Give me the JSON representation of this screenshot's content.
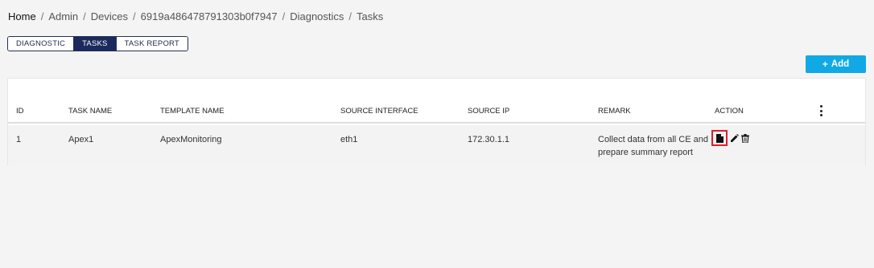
{
  "breadcrumb": {
    "home": "Home",
    "admin": "Admin",
    "devices": "Devices",
    "device_id": "6919a486478791303b0f7947",
    "diagnostics": "Diagnostics",
    "current": "Tasks",
    "separator": "/"
  },
  "tabs": [
    {
      "label": "DIAGNOSTIC",
      "active": false
    },
    {
      "label": "TASKS",
      "active": true
    },
    {
      "label": "TASK REPORT",
      "active": false
    }
  ],
  "add_button": {
    "icon": "plus-icon",
    "label": "Add",
    "glyph": "+",
    "color": "#10a9e6"
  },
  "table": {
    "columns": {
      "id": "ID",
      "task_name": "TASK NAME",
      "template_name": "TEMPLATE NAME",
      "source_interface": "SOURCE INTERFACE",
      "source_ip": "SOURCE IP",
      "remark": "REMARK",
      "action": "ACTION"
    },
    "rows": [
      {
        "id": "1",
        "task_name": "Apex1",
        "template_name": "ApexMonitoring",
        "source_interface": "eth1",
        "source_ip": "172.30.1.1",
        "remark": "Collect data from all CE and prepare summary report",
        "actions": [
          "report-icon",
          "edit-icon",
          "delete-icon"
        ]
      }
    ]
  },
  "colors": {
    "tab_active": "#1a2a5c",
    "highlight": "#e01e2a",
    "background": "#f4f4f4"
  }
}
